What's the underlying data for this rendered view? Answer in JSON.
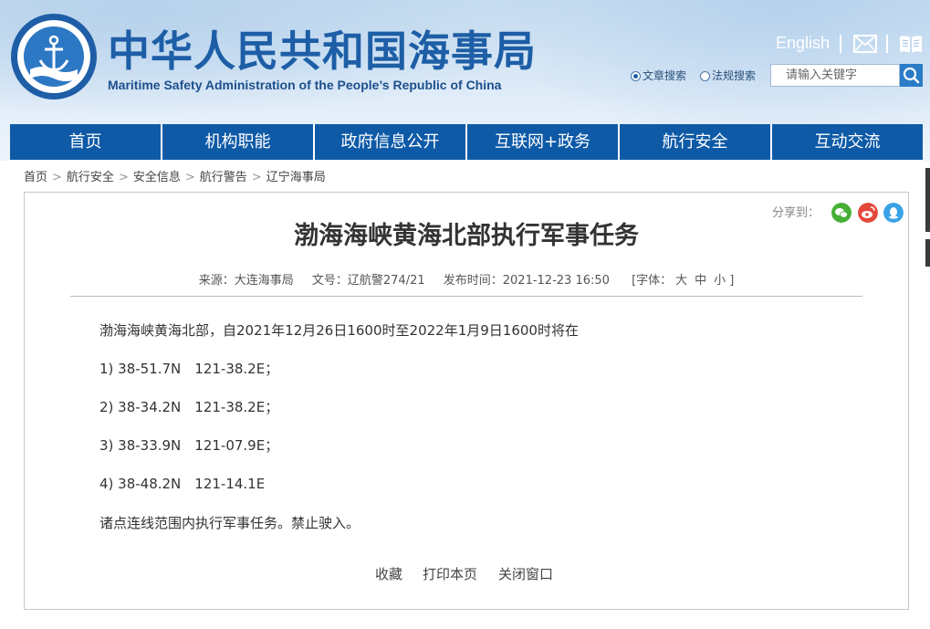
{
  "header": {
    "title_cn": "中华人民共和国海事局",
    "title_en": "Maritime Safety Administration of the People’s Republic of China",
    "emblem_text_cn": "中国海事",
    "emblem_text_en": "CHINA MSA",
    "lang_link": "English",
    "mail_icon": "mail-icon",
    "book_icon": "book-icon",
    "search": {
      "options": [
        "文章搜索",
        "法规搜索"
      ],
      "selected": "文章搜索",
      "placeholder": "请输入关键字",
      "icon": "search-icon"
    }
  },
  "nav": {
    "items": [
      "首页",
      "机构职能",
      "政府信息公开",
      "互联网+政务",
      "航行安全",
      "互动交流"
    ]
  },
  "breadcrumb": [
    "首页",
    "航行安全",
    "安全信息",
    "航行警告",
    "辽宁海事局"
  ],
  "share": {
    "label": "分享到：",
    "icons": [
      "wechat-icon",
      "weibo-icon",
      "qq-icon"
    ]
  },
  "article": {
    "title": "渤海海峡黄海北部执行军事任务",
    "meta": {
      "source": "来源：大连海事局",
      "doc_no": "文号：辽航警274/21",
      "published": "发布时间：2021-12-23 16:50",
      "font_label": "[字体：",
      "font_sizes": [
        "大",
        "中",
        "小"
      ],
      "font_close": "]"
    },
    "paragraphs": [
      "渤海海峡黄海北部，自2021年12月26日1600时至2022年1月9日1600时将在",
      "1) 38-51.7N　121-38.2E；",
      "2) 38-34.2N　121-38.2E；",
      "3) 38-33.9N　121-07.9E；",
      "4) 38-48.2N　121-14.1E",
      "诸点连线范围内执行军事任务。禁止驶入。"
    ],
    "actions": [
      "收藏",
      "打印本页",
      "关闭窗口"
    ]
  },
  "colors": {
    "nav_bg": "#0e5aa7",
    "title_blue": "#1d5ea6",
    "search_btn": "#2a7cc7"
  }
}
